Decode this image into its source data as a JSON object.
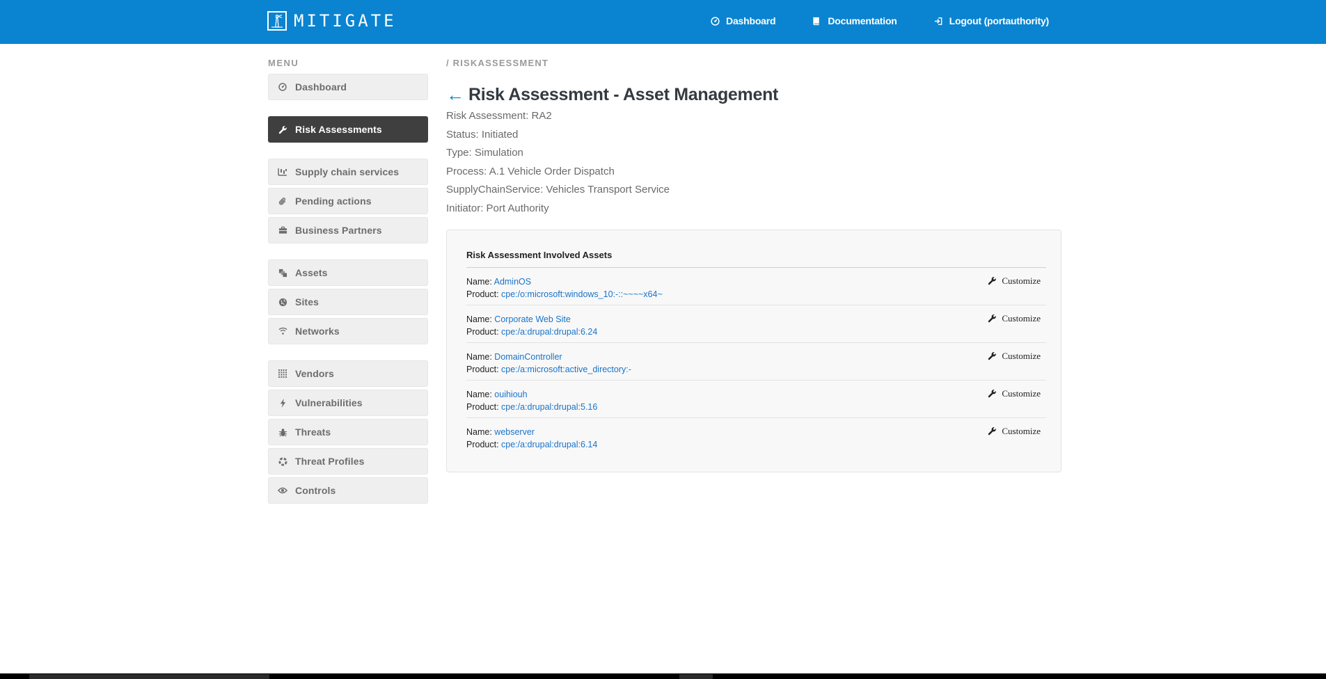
{
  "app": {
    "brand_name": "MITIGATE"
  },
  "topnav": {
    "items": [
      {
        "label": "Dashboard",
        "icon": "dashboard-icon"
      },
      {
        "label": "Documentation",
        "icon": "book-icon"
      },
      {
        "label": "Logout (portauthority)",
        "icon": "logout-icon"
      }
    ]
  },
  "sidebar": {
    "menu_label": "MENU",
    "items": [
      {
        "label": "Dashboard",
        "icon": "dashboard-icon"
      },
      {
        "label": "Risk Assessments",
        "icon": "wrench-icon",
        "active": true
      },
      {
        "label": "Supply chain services",
        "icon": "chain-icon"
      },
      {
        "label": "Pending actions",
        "icon": "paperclip-icon"
      },
      {
        "label": "Business Partners",
        "icon": "briefcase-icon"
      },
      {
        "label": "Assets",
        "icon": "assets-icon"
      },
      {
        "label": "Sites",
        "icon": "globe-icon"
      },
      {
        "label": "Networks",
        "icon": "wifi-icon"
      },
      {
        "label": "Vendors",
        "icon": "grid-icon"
      },
      {
        "label": "Vulnerabilities",
        "icon": "bolt-icon"
      },
      {
        "label": "Threats",
        "icon": "bug-icon"
      },
      {
        "label": "Threat Profiles",
        "icon": "spinner-icon"
      },
      {
        "label": "Controls",
        "icon": "eye-icon"
      }
    ]
  },
  "main": {
    "breadcrumb": "/ RISKASSESSMENT",
    "back_arrow": "←",
    "title": "Risk Assessment - Asset Management",
    "info": [
      "Risk Assessment: RA2",
      "Status: Initiated",
      "Type: Simulation",
      "Process: A.1 Vehicle Order Dispatch",
      "SupplyChainService: Vehicles Transport Service",
      "Initiator: Port Authority"
    ],
    "panel": {
      "title": "Risk Assessment Involved Assets",
      "name_label": "Name: ",
      "product_label": "Product: ",
      "customize_label": "Customize",
      "assets": [
        {
          "name": "AdminOS",
          "product": "cpe:/o:microsoft:windows_10:-::~~~~x64~"
        },
        {
          "name": "Corporate Web Site",
          "product": "cpe:/a:drupal:drupal:6.24"
        },
        {
          "name": "DomainController",
          "product": "cpe:/a:microsoft:active_directory:-"
        },
        {
          "name": "ouihiouh",
          "product": "cpe:/a:drupal:drupal:5.16"
        },
        {
          "name": "webserver",
          "product": "cpe:/a:drupal:drupal:6.14"
        }
      ]
    }
  },
  "colors": {
    "topbar": "#0a84d0",
    "sidebar_active": "#3f3f3f",
    "link": "#1a73c9"
  }
}
